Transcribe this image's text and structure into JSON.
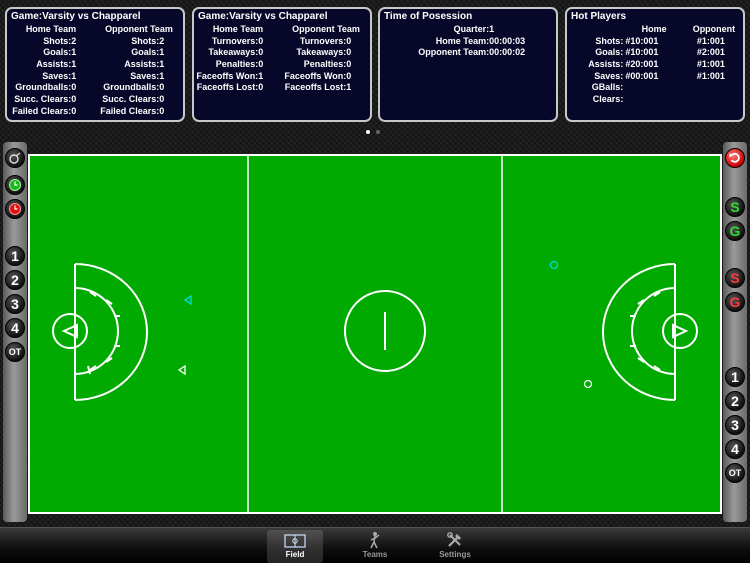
{
  "panels": {
    "game_stats_1": {
      "title": "Game:Varsity vs Chapparel",
      "home_header": "Home Team",
      "opp_header": "Opponent Team",
      "home": [
        {
          "label": "Shots:",
          "value": "2"
        },
        {
          "label": "Goals:",
          "value": "1"
        },
        {
          "label": "Assists:",
          "value": "1"
        },
        {
          "label": "Saves:",
          "value": "1"
        },
        {
          "label": "Groundballs:",
          "value": "0"
        },
        {
          "label": "Succ. Clears:",
          "value": "0"
        },
        {
          "label": "Failed Clears:",
          "value": "0"
        }
      ],
      "opp": [
        {
          "label": "Shots:",
          "value": "2"
        },
        {
          "label": "Goals:",
          "value": "1"
        },
        {
          "label": "Assists:",
          "value": "1"
        },
        {
          "label": "Saves:",
          "value": "1"
        },
        {
          "label": "Groundballs:",
          "value": "0"
        },
        {
          "label": "Succ. Clears:",
          "value": "0"
        },
        {
          "label": "Failed Clears:",
          "value": "0"
        }
      ]
    },
    "game_stats_2": {
      "title": "Game:Varsity vs Chapparel",
      "home_header": "Home Team",
      "opp_header": "Opponent Team",
      "home": [
        {
          "label": "Turnovers:",
          "value": "0"
        },
        {
          "label": "Takeaways:",
          "value": "0"
        },
        {
          "label": "Penalties:",
          "value": "0"
        },
        {
          "label": "Faceoffs Won:",
          "value": "1"
        },
        {
          "label": "Faceoffs Lost:",
          "value": "0"
        }
      ],
      "opp": [
        {
          "label": "Turnovers:",
          "value": "0"
        },
        {
          "label": "Takeaways:",
          "value": "0"
        },
        {
          "label": "Penalties:",
          "value": "0"
        },
        {
          "label": "Faceoffs Won:",
          "value": "0"
        },
        {
          "label": "Faceoffs Lost:",
          "value": "1"
        }
      ]
    },
    "possession": {
      "title": "Time of Posession",
      "rows": [
        {
          "label": "Quarter:",
          "value": "1"
        },
        {
          "label": "Home Team:",
          "value": "00:00:03"
        },
        {
          "label": "Opponent Team:",
          "value": "00:00:02"
        }
      ]
    },
    "hot_players": {
      "title": "Hot Players",
      "home_header": "Home",
      "opp_header": "Opponent",
      "rows": [
        {
          "label": "Shots:",
          "home": "#10:001",
          "opp": "#1:001"
        },
        {
          "label": "Goals:",
          "home": "#10:001",
          "opp": "#2:001"
        },
        {
          "label": "Assists:",
          "home": "#20:001",
          "opp": "#1:001"
        },
        {
          "label": "Saves:",
          "home": "#00:001",
          "opp": "#1:001"
        },
        {
          "label": "GBalls:",
          "home": "",
          "opp": ""
        },
        {
          "label": "Clears:",
          "home": "",
          "opp": ""
        }
      ]
    }
  },
  "left_rail": {
    "top_icons": [
      "whistle-icon",
      "green-clock-icon",
      "red-clock-icon"
    ],
    "quarters": [
      "1",
      "2",
      "3",
      "4",
      "OT"
    ]
  },
  "right_rail": {
    "undo_icon": "undo-icon",
    "home_buttons": [
      "S",
      "G"
    ],
    "opp_buttons": [
      "S",
      "G"
    ],
    "quarters": [
      "1",
      "2",
      "3",
      "4",
      "OT"
    ]
  },
  "colors": {
    "field": "#00aa00",
    "lines": "#ffffff",
    "marker": "#00dddd",
    "panel_bg": "#07072a",
    "home_button": "#2ede2e",
    "opp_button": "#ff3b3b"
  },
  "tabs": [
    {
      "label": "Field",
      "icon": "field-icon",
      "active": true
    },
    {
      "label": "Teams",
      "icon": "player-icon",
      "active": false
    },
    {
      "label": "Settings",
      "icon": "tools-icon",
      "active": false
    }
  ],
  "page_indicator": {
    "pages": 2,
    "current": 1
  }
}
